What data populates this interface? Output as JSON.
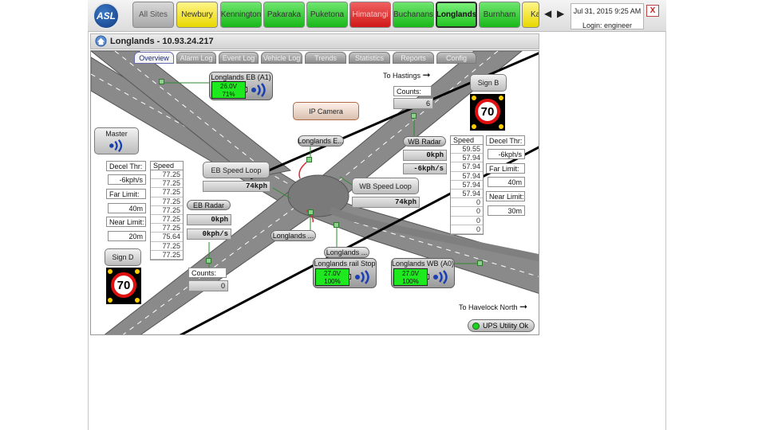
{
  "header": {
    "logo_text": "ASL",
    "site_tabs": [
      {
        "label": "All Sites",
        "state": "grey"
      },
      {
        "label": "Newbury",
        "state": "yellow"
      },
      {
        "label": "Kennington",
        "state": "green"
      },
      {
        "label": "Pakaraka",
        "state": "green"
      },
      {
        "label": "Puketona",
        "state": "green"
      },
      {
        "label": "Himatangi",
        "state": "red"
      },
      {
        "label": "Buchanans",
        "state": "green"
      },
      {
        "label": "Longlands",
        "state": "active"
      },
      {
        "label": "Burnham",
        "state": "green"
      },
      {
        "label": "Ka",
        "state": "yellow"
      }
    ],
    "nav_prev": "◀",
    "nav_next": "▶",
    "datetime": "Jul 31, 2015 9:25 AM",
    "login": "Login: engineer",
    "close_label": "X"
  },
  "panel": {
    "title": "Longlands - 10.93.24.217",
    "view_tabs": [
      "Overview",
      "Alarm Log",
      "Event Log",
      "Vehicle Log",
      "Trends",
      "Statistics",
      "Reports",
      "Config"
    ],
    "active_tab": "Overview"
  },
  "map": {
    "to_hastings": "To Hastings",
    "to_havelock": "To Havelock North",
    "ip_camera": "IP Camera",
    "master": "Master",
    "sign_b": {
      "label": "Sign B",
      "speed": "70"
    },
    "sign_d": {
      "label": "Sign D",
      "speed": "70"
    },
    "eb_a1": {
      "name": "Longlands EB (A1)",
      "voltage": "26.0V",
      "percent": "71%",
      "level": 0.71
    },
    "rail_stop": {
      "name": "Longlands rail Stop",
      "voltage": "27.0V",
      "percent": "100%",
      "level": 1.0
    },
    "wb_a0": {
      "name": "Longlands WB (A0)",
      "voltage": "27.0V",
      "percent": "100%",
      "level": 1.0
    },
    "longlands_e": "Longlands E...",
    "longlands_w": "Longlands ...",
    "longlands_s": "Longlands ...",
    "wb_radar": {
      "label": "WB Radar",
      "speed": "0kph",
      "accel": "-6kph/s"
    },
    "eb_radar": {
      "label": "EB Radar",
      "speed": "0kph",
      "accel": "0kph/s"
    },
    "eb_speed_loop": {
      "label": "EB Speed Loop",
      "value": "74kph"
    },
    "wb_speed_loop": {
      "label": "WB Speed Loop",
      "value": "74kph"
    },
    "counts_top": {
      "label": "Counts:",
      "value": "6"
    },
    "counts_bottom": {
      "label": "Counts:",
      "value": "0"
    },
    "left_params": {
      "decel_label": "Decel Thr:",
      "decel_value": "-6kph/s",
      "far_label": "Far Limit:",
      "far_value": "40m",
      "near_label": "Near Limit:",
      "near_value": "20m"
    },
    "right_params": {
      "decel_label": "Decel Thr:",
      "decel_value": "-6kph/s",
      "far_label": "Far Limit:",
      "far_value": "40m",
      "near_label": "Near Limit:",
      "near_value": "30m"
    },
    "left_speed": {
      "header": "Speed",
      "values": [
        "77.25",
        "77.25",
        "77.25",
        "77.25",
        "77.25",
        "77.25",
        "77.25",
        "75.64",
        "77.25",
        "77.25"
      ]
    },
    "right_speed": {
      "header": "Speed",
      "values": [
        "59.55",
        "57.94",
        "57.94",
        "57.94",
        "57.94",
        "57.94",
        "0",
        "0",
        "0",
        "0"
      ]
    },
    "ups": "UPS Utility Ok"
  },
  "colors": {
    "green": "#1ee81e",
    "red": "#e01010",
    "sign_yellow": "#ffd000"
  }
}
